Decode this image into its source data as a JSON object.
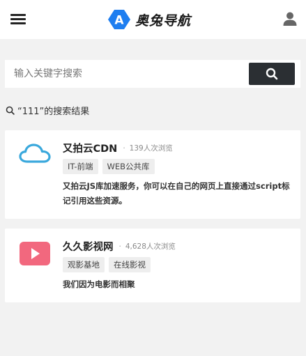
{
  "header": {
    "logo_letter": "A",
    "logo_text": "奥兔导航",
    "colors": {
      "brand": "#1e7ef0"
    },
    "icons": {
      "menu": "menu-icon",
      "user": "user-icon"
    }
  },
  "search": {
    "placeholder": "输入关键字搜索",
    "value": "",
    "button_icon": "search-icon"
  },
  "results": {
    "title": "“111”的搜索结果",
    "items": [
      {
        "name": "又拍云CDN",
        "views": "139人次浏览",
        "tags": [
          "IT-前端",
          "WEB公共库"
        ],
        "description": "又拍云JS库加速服务，你可以在自己的网页上直接通过script标记引用这些资源。",
        "icon": "cloud-icon",
        "icon_color": "#3aa8dc"
      },
      {
        "name": "久久影视网",
        "views": "4,628人次浏览",
        "tags": [
          "观影基地",
          "在线影视"
        ],
        "description": "我们因为电影而相聚",
        "icon": "play-icon",
        "icon_color": "#f2687e"
      }
    ]
  }
}
